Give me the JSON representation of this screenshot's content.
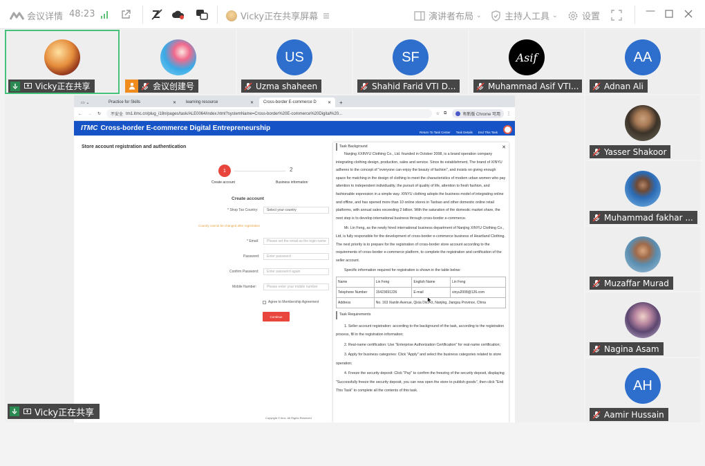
{
  "toolbar": {
    "meeting_details": "会议详情",
    "duration": "48:23",
    "sharing_status": "Vicky正在共享屏幕",
    "presenter_layout": "演讲者布局",
    "host_tools": "主持人工具",
    "settings": "设置"
  },
  "tiles": [
    {
      "label": "Vicky正在共享"
    },
    {
      "label": "会议创建号"
    },
    {
      "label": "Uzma shaheen",
      "initials": "US",
      "color": "#2e6fce"
    },
    {
      "label": "Shahid Farid VTI D...",
      "initials": "SF",
      "color": "#2e6fce"
    },
    {
      "label": "Muhammad Asif VTI...",
      "initials": "Asif"
    },
    {
      "label": "Adnan Ali",
      "initials": "AA",
      "color": "#2e6fce"
    },
    {
      "label": "Yasser Shakoor"
    },
    {
      "label": "Muhammad fakhar ..."
    },
    {
      "label": "Muzaffar Murad"
    },
    {
      "label": "Nagina Asam"
    },
    {
      "label": "Aamir Hussain",
      "initials": "AH",
      "color": "#2e6fce"
    }
  ],
  "share_label": "Vicky正在共享",
  "browser": {
    "tabs": [
      "Practice for Skills",
      "learning resource",
      "Cross-border E-commerce D"
    ],
    "url_insecure": "不安全",
    "url": "tm1.itmc.cn/plug_i18n/pages/task/ALE0064/index.html?systemName=Cross-border%20E-commerce%20Digital%20...",
    "chrome_notice": "有新版 Chrome 可用"
  },
  "site": {
    "logo": "ITMC",
    "title": "Cross-border E-commerce Digital Entrepreneurship",
    "nav": [
      "Return To Task Center",
      "Task Details",
      "End This Task"
    ],
    "page_title": "Store account registration and authentication",
    "step1_num": "1",
    "step1_label": "Create account",
    "step2_num": "2",
    "step2_label": "Business information",
    "form_title": "Create account",
    "country_label": "* Shop Tax Country:",
    "country_placeholder": "Select your country",
    "country_note": "Country cannot be changed after registration",
    "email_label": "* Email:",
    "email_placeholder": "Please set the email as the login name",
    "password_label": "Password:",
    "password_placeholder": "Enter password",
    "confirm_label": "Confirm Password:",
    "confirm_placeholder": "Enter password again",
    "mobile_label": "Mobile Number:",
    "mobile_placeholder": "Please enter your mobile number",
    "agree": "Agree to Membership Agreement",
    "continue": "Continue",
    "copyright": "Copyright © itmc. All Rights Reserved"
  },
  "task_panel": {
    "heading": "Task Background",
    "para1": "Nanjing XXINYU Clothing Co., Ltd. founded in October 2008, is a brand operation company integrating clothing design, production, sales and service. Since its establishment, The brand of XINYU adheres to the concept of \"everyone can enjoy the beauty of fashion\", and insists on giving enough space for matching in the design of clothing to meet the characteristics of modern urban women who pay attention to independent individuality, the pursuit of quality of life, attention to fresh fashion, and fashionable expression in a simple way. XINYU clothing adopts the business model of integrating online and offline, and has opened more than 10 online stores in Taobao and other domestic online retail platforms, with annual sales exceeding 2 billion. With the saturation of the domestic market share, the next step is to develop international business through cross-border e-commerce.",
    "para2": "Mr. Lin Feng, as the newly hired international business department of Nanjing XINYU Clothing Co., Ltd, is fully responsible for the development of cross-border e-commerce business of Heartland Clothing. The next priority is to prepare for the registration of cross-border store account according to the requirements of cross-border e-commerce platform, to complete the registration and certification of the seller account.",
    "para3": "Specific information required for registration is shown in the table below:",
    "table": [
      [
        "Name",
        "Lin Feng",
        "English Name",
        "Lin Feng"
      ],
      [
        "Telephone Number",
        "15423691226",
        "E-mail",
        "xinyu2008@126.com"
      ]
    ],
    "address_label": "Address",
    "address_value": "No. 163 Xianlin Avenue, Qixia District, Nanjing, Jiangsu Province, China",
    "req_heading": "Task Requirements",
    "req1": "1. Seller account registration: according to the background of the task, according to the registration process, fill in the registration information;",
    "req2": "2. Real-name certification: Use \"Enterprise Authorization Certification\" for real-name certification;",
    "req3": "3. Apply for business categories: Click \"Apply\" and select the business categories related to store operation;",
    "req4": "4. Freeze the security deposit: Click \"Pay\" to confirm the freezing of the security deposit, displaying \"Successfully freeze the security deposit, you can now open the store to publish goods\", then click \"End This Task\" to complete all the contents of this task."
  }
}
